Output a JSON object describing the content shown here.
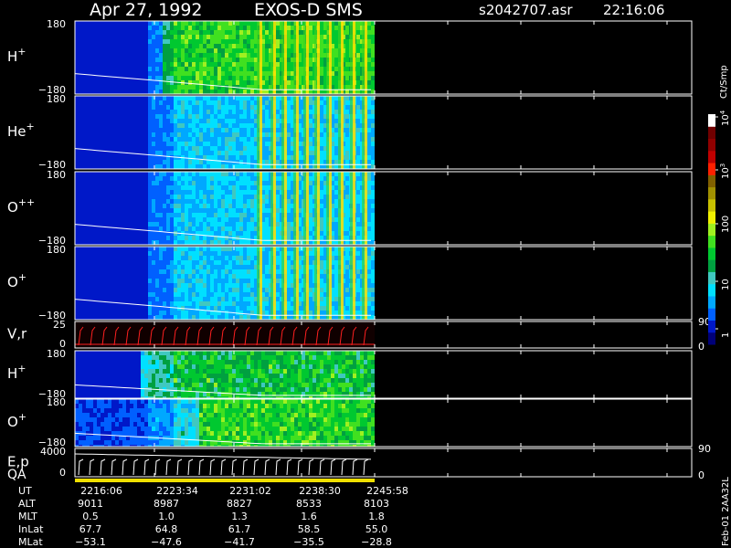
{
  "header": {
    "date": "Apr 27, 1992",
    "mission": "EXOS-D SMS",
    "file": "s2042707.asr",
    "time": "22:16:06"
  },
  "colorbar": {
    "unit": "Ct/Smp",
    "ticks": [
      "1",
      "10",
      "100",
      "10",
      "10"
    ],
    "tick_exponents": [
      "",
      "",
      "",
      "3",
      "4"
    ],
    "colors": [
      "#000078",
      "#0018c8",
      "#0060ff",
      "#00a8ff",
      "#00e0ff",
      "#40c8c0",
      "#00a040",
      "#00c830",
      "#40e020",
      "#a0f020",
      "#f0f000",
      "#c8c000",
      "#a09000",
      "#806000",
      "#ff2000",
      "#c00000",
      "#900000",
      "#700000",
      "#ffffff"
    ]
  },
  "footer": {
    "stamp": "Feb-01 2AA32L",
    "labels": [
      "UT",
      "ALT",
      "MLT",
      "InLat",
      "MLat"
    ],
    "columns": [
      [
        "2216:06",
        "9011",
        "0.5",
        "67.7",
        "−53.1"
      ],
      [
        "2223:34",
        "8987",
        "1.0",
        "64.8",
        "−47.6"
      ],
      [
        "2231:02",
        "8827",
        "1.3",
        "61.7",
        "−41.7"
      ],
      [
        "2238:30",
        "8533",
        "1.6",
        "58.5",
        "−35.5"
      ],
      [
        "2245:58",
        "8103",
        "1.8",
        "55.0",
        "−28.8"
      ]
    ]
  },
  "chart_data": {
    "type": "heatmap",
    "title": "Apr 27, 1992   EXOS-D SMS",
    "x": [
      "2216:06",
      "2223:34",
      "2231:02",
      "2238:30",
      "2245:58"
    ],
    "colorscale": {
      "label": "Ct/Smp",
      "scale": "log",
      "range": [
        1,
        10000
      ]
    },
    "panels": [
      {
        "species": "H",
        "charge": "+",
        "y_top": "180",
        "y_bottom": "−180",
        "ylim": [
          -180,
          180
        ],
        "right_labels": []
      },
      {
        "species": "He",
        "charge": "+",
        "y_top": "180",
        "y_bottom": "−180",
        "ylim": [
          -180,
          180
        ],
        "right_labels": []
      },
      {
        "species": "O",
        "charge": "++",
        "y_top": "180",
        "y_bottom": "−180",
        "ylim": [
          -180,
          180
        ],
        "right_labels": []
      },
      {
        "species": "O",
        "charge": "+",
        "y_top": "180",
        "y_bottom": "−180",
        "ylim": [
          -180,
          180
        ],
        "right_labels": []
      },
      {
        "species": "V,r",
        "charge": "",
        "y_top": "25",
        "y_bottom": "0",
        "ylim": [
          0,
          25
        ],
        "right_labels": [
          "90",
          "0"
        ]
      },
      {
        "species": "H",
        "charge": "+",
        "y_top": "180",
        "y_bottom": "−180",
        "ylim": [
          -180,
          180
        ],
        "right_labels": []
      },
      {
        "species": "O",
        "charge": "+",
        "y_top": "180",
        "y_bottom": "−180",
        "ylim": [
          -180,
          180
        ],
        "right_labels": []
      },
      {
        "species": "E,p",
        "charge": "",
        "y_top": "4000",
        "y_bottom": "0",
        "ylim": [
          0,
          4000
        ],
        "right_labels": [
          "90",
          "0"
        ]
      }
    ],
    "qa_label": "QA"
  }
}
